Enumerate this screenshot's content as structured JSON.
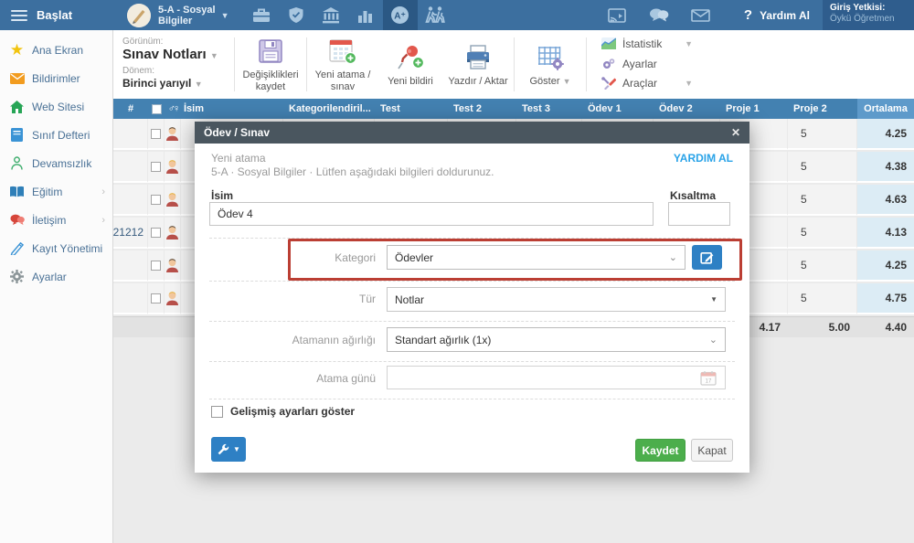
{
  "topbar": {
    "menu_label": "Başlat",
    "class_name_line1": "5-A - Sosyal",
    "class_name_line2": "Bilgiler",
    "icons": [
      "briefcase-icon",
      "shield-icon",
      "institution-icon",
      "bar-chart-icon",
      "grades-icon",
      "attendance-icon"
    ],
    "right_icons": [
      "cast-icon",
      "chat-icon",
      "mail-icon",
      "help-icon"
    ],
    "help_q": "?",
    "help_label": "Yardım Al",
    "login_role_label": "Giriş Yetkisi:",
    "login_user": "Öykü Öğretmen"
  },
  "sidebar": {
    "items": [
      {
        "label": "Ana Ekran",
        "icon": "star-icon"
      },
      {
        "label": "Bildirimler",
        "icon": "mail-icon"
      },
      {
        "label": "Web Sitesi",
        "icon": "home-icon"
      },
      {
        "label": "Sınıf Defteri",
        "icon": "notebook-icon"
      },
      {
        "label": "Devamsızlık",
        "icon": "person-icon"
      },
      {
        "label": "Eğitim",
        "icon": "education-icon",
        "chevron": "›"
      },
      {
        "label": "İletişim",
        "icon": "chat-icon",
        "chevron": "›"
      },
      {
        "label": "Kayıt Yönetimi",
        "icon": "pen-icon"
      },
      {
        "label": "Ayarlar",
        "icon": "gear-icon"
      }
    ]
  },
  "toolbar": {
    "view_label": "Görünüm:",
    "view_value": "Sınav Notları",
    "term_label": "Dönem:",
    "term_value": "Birinci yarıyıl",
    "save_label": "Değişiklikleri kaydet",
    "new_assignment_label": "Yeni atama / sınav",
    "new_post_label": "Yeni bildiri",
    "print_label": "Yazdır / Aktar",
    "show_label": "Göster",
    "statistics_label": "İstatistik",
    "settings_label": "Ayarlar",
    "tools_label": "Araçlar"
  },
  "table": {
    "header": {
      "num": "#",
      "gender": "♂♀",
      "name": "İsim",
      "category": "Kategorilendiril...",
      "test": "Test",
      "test2": "Test 2",
      "test3": "Test 3",
      "odev1": "Ödev 1",
      "odev2": "Ödev 2",
      "proje1": "Proje 1",
      "proje2": "Proje 2",
      "average": "Ortalama"
    },
    "rows": [
      {
        "num": "",
        "proje2": "5",
        "ortalama": "4.25"
      },
      {
        "num": "",
        "proje2": "5",
        "ortalama": "4.38"
      },
      {
        "num": "",
        "proje2": "5",
        "ortalama": "4.63"
      },
      {
        "num": "21212",
        "proje2": "5",
        "ortalama": "4.13"
      },
      {
        "num": "",
        "proje2": "5",
        "ortalama": "4.25"
      },
      {
        "num": "",
        "proje2": "5",
        "ortalama": "4.75"
      }
    ],
    "summary": {
      "proje1": "4.17",
      "proje2": "5.00",
      "ortalama": "4.40"
    }
  },
  "modal": {
    "title": "Ödev / Sınav",
    "close": "✕",
    "heading": "Yeni atama",
    "subheading": "5-A · Sosyal Bilgiler · Lütfen aşağıdaki bilgileri doldurunuz.",
    "help_link": "YARDIM AL",
    "name_label": "İsim",
    "name_value": "Ödev 4",
    "abbr_label": "Kısaltma",
    "abbr_value": "",
    "category_label": "Kategori",
    "category_value": "Ödevler",
    "type_label": "Tür",
    "type_value": "Notlar",
    "weight_label": "Atamanın ağırlığı",
    "weight_value": "Standart ağırlık (1x)",
    "date_label": "Atama günü",
    "date_value": "",
    "advanced_label": "Gelişmiş ayarları göster",
    "save_label": "Kaydet",
    "cancel_label": "Kapat"
  },
  "colors": {
    "topbar": "#3c6f9f",
    "topbar_active": "#2b5884",
    "table_header": "#4381b1",
    "average_header": "#5e9aca",
    "average_cell": "#dcecf5",
    "accent_blue": "#2e80c4",
    "save_green": "#4cae4c",
    "annotation_red": "#bb3e33",
    "help_link": "#2aa3e8"
  }
}
